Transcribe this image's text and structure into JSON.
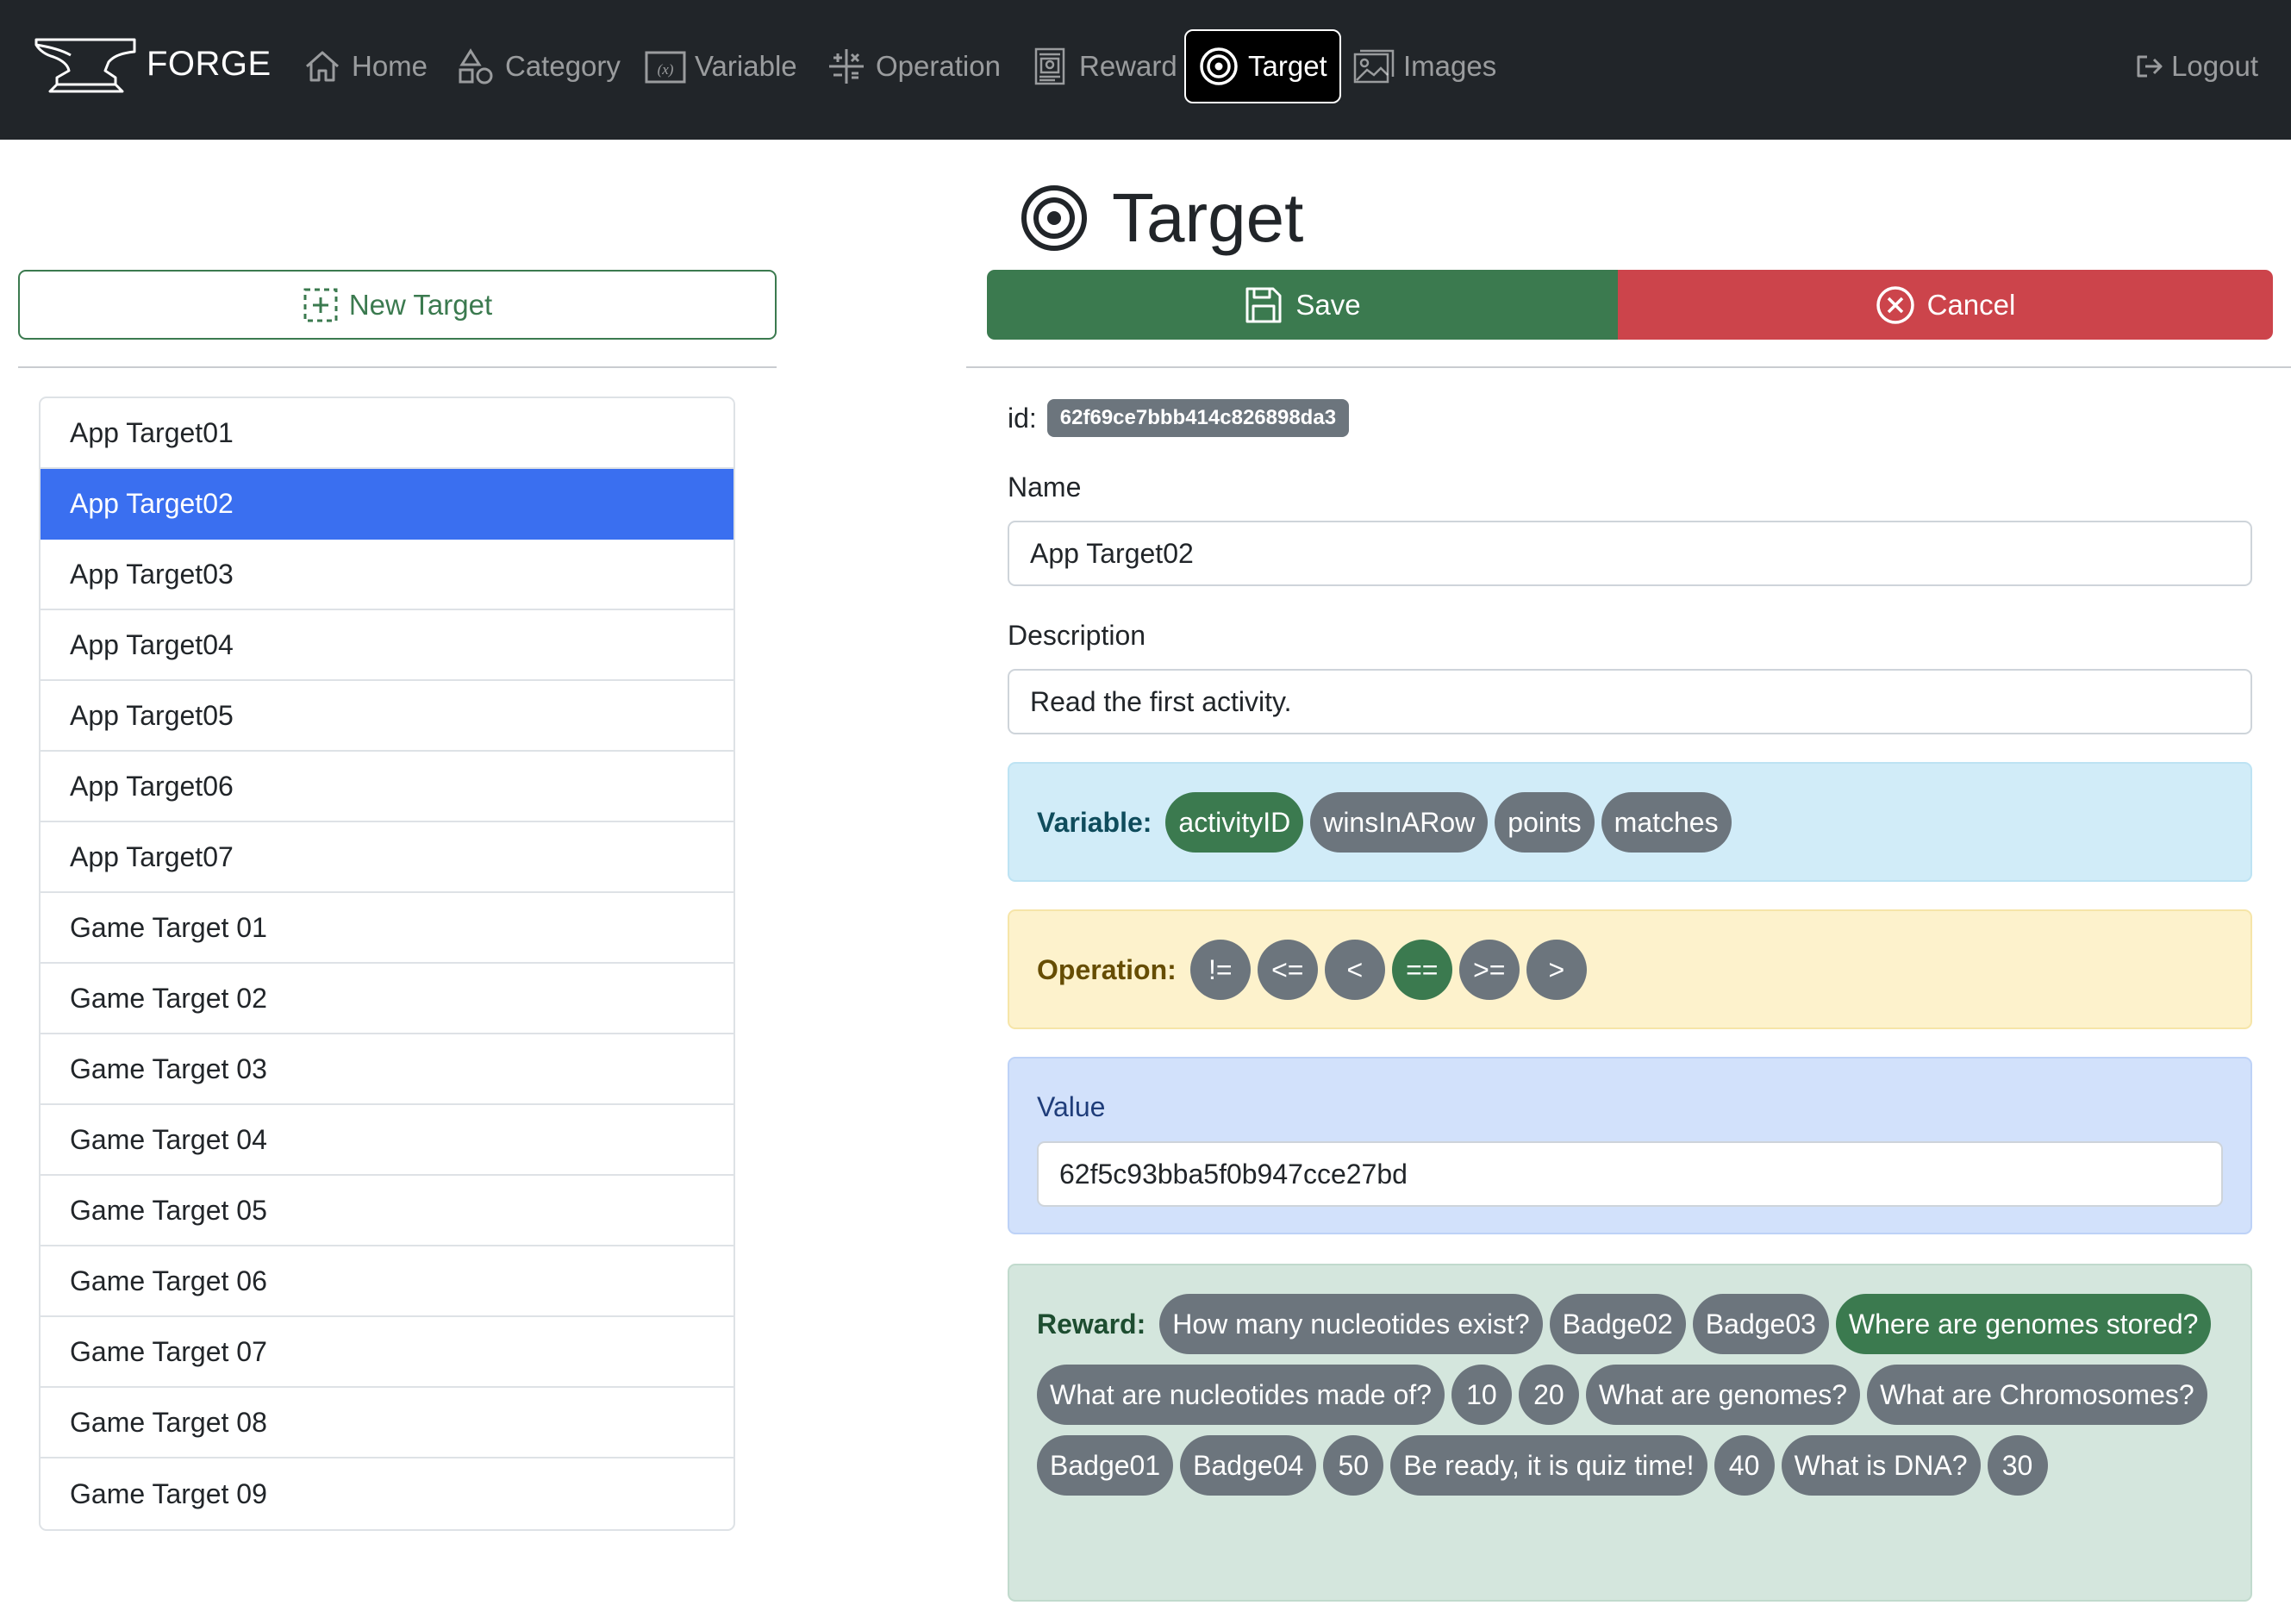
{
  "colors": {
    "navbar_bg": "#212529",
    "primary": "#3a6ff0",
    "success": "#3b7a4f",
    "danger": "#cc444b",
    "secondary_pill": "#6c757d",
    "variable_panel": "#d1ecf8",
    "operation_panel": "#fdf2cc",
    "value_panel": "#d2e1fb",
    "reward_panel": "#d4e6dd"
  },
  "navbar": {
    "brand": "FORGE",
    "brand_icon": "anvil-icon",
    "items": [
      {
        "label": "Home",
        "icon": "home-icon"
      },
      {
        "label": "Category",
        "icon": "shapes-icon"
      },
      {
        "label": "Variable",
        "icon": "variable-icon"
      },
      {
        "label": "Operation",
        "icon": "operation-icon"
      },
      {
        "label": "Reward",
        "icon": "wanted-poster-icon"
      },
      {
        "label": "Target",
        "icon": "target-icon",
        "active": true
      },
      {
        "label": "Images",
        "icon": "images-icon"
      }
    ],
    "logout": {
      "label": "Logout",
      "icon": "logout-icon"
    }
  },
  "sidebar": {
    "new_button": {
      "label": "New Target",
      "icon": "plus-square-dashed-icon"
    },
    "items": [
      "App Target01",
      "App Target02",
      "App Target03",
      "App Target04",
      "App Target05",
      "App Target06",
      "App Target07",
      "Game Target 01",
      "Game Target 02",
      "Game Target 03",
      "Game Target 04",
      "Game Target 05",
      "Game Target 06",
      "Game Target 07",
      "Game Target 08",
      "Game Target 09"
    ],
    "selected": "App Target02"
  },
  "main": {
    "title": "Target",
    "title_icon": "target-icon",
    "save_label": "Save",
    "cancel_label": "Cancel",
    "id_label": "id:",
    "id_value": "62f69ce7bbb414c826898da3",
    "name_label": "Name",
    "name_value": "App Target02",
    "description_label": "Description",
    "description_value": "Read the first activity.",
    "variable": {
      "label": "Variable:",
      "options": [
        {
          "label": "activityID",
          "selected": true
        },
        {
          "label": "winsInARow",
          "selected": false
        },
        {
          "label": "points",
          "selected": false
        },
        {
          "label": "matches",
          "selected": false
        }
      ]
    },
    "operation": {
      "label": "Operation:",
      "options": [
        {
          "label": "!=",
          "selected": false
        },
        {
          "label": "<=",
          "selected": false
        },
        {
          "label": "<",
          "selected": false
        },
        {
          "label": "==",
          "selected": true
        },
        {
          "label": ">=",
          "selected": false
        },
        {
          "label": ">",
          "selected": false
        }
      ]
    },
    "value": {
      "label": "Value",
      "value": "62f5c93bba5f0b947cce27bd"
    },
    "reward": {
      "label": "Reward:",
      "options": [
        {
          "label": "How many nucleotides exist?",
          "selected": false
        },
        {
          "label": "Badge02",
          "selected": false
        },
        {
          "label": "Badge03",
          "selected": false
        },
        {
          "label": "Where are genomes stored?",
          "selected": true
        },
        {
          "label": "What are nucleotides made of?",
          "selected": false
        },
        {
          "label": "10",
          "selected": false
        },
        {
          "label": "20",
          "selected": false
        },
        {
          "label": "What are genomes?",
          "selected": false
        },
        {
          "label": "What are Chromosomes?",
          "selected": false
        },
        {
          "label": "Badge01",
          "selected": false
        },
        {
          "label": "Badge04",
          "selected": false
        },
        {
          "label": "50",
          "selected": false
        },
        {
          "label": "Be ready, it is quiz time!",
          "selected": false
        },
        {
          "label": "40",
          "selected": false
        },
        {
          "label": "What is DNA?",
          "selected": false
        },
        {
          "label": "30",
          "selected": false
        }
      ]
    }
  }
}
